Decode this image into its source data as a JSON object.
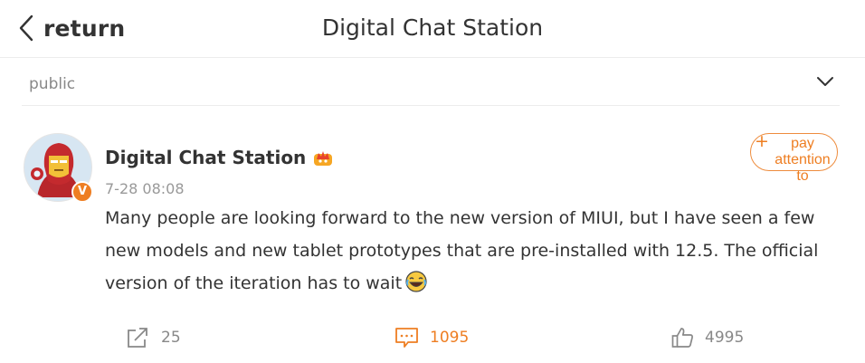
{
  "header": {
    "back_label": "return",
    "title": "Digital Chat Station"
  },
  "filter": {
    "label": "public"
  },
  "post": {
    "author": "Digital Chat Station",
    "time": "7-28 08:08",
    "verified_badge": "V",
    "follow_label": "pay attention to",
    "body": "Many people are looking forward to the new version of MIUI, but I have seen a few new models and new tablet prototypes that are pre-installed with 12.5. The official version of the iteration has to wait",
    "actions": {
      "repost_count": "25",
      "comment_count": "1095",
      "like_count": "4995"
    }
  },
  "colors": {
    "accent": "#ee7e22",
    "text": "#333333",
    "muted": "#888888",
    "divider": "#ececec"
  },
  "icons": [
    "chevron-left-icon",
    "chevron-down-icon",
    "crown-badge-icon",
    "verified-icon",
    "laughing-emoji-icon",
    "share-icon",
    "comment-icon",
    "thumbs-up-icon"
  ]
}
